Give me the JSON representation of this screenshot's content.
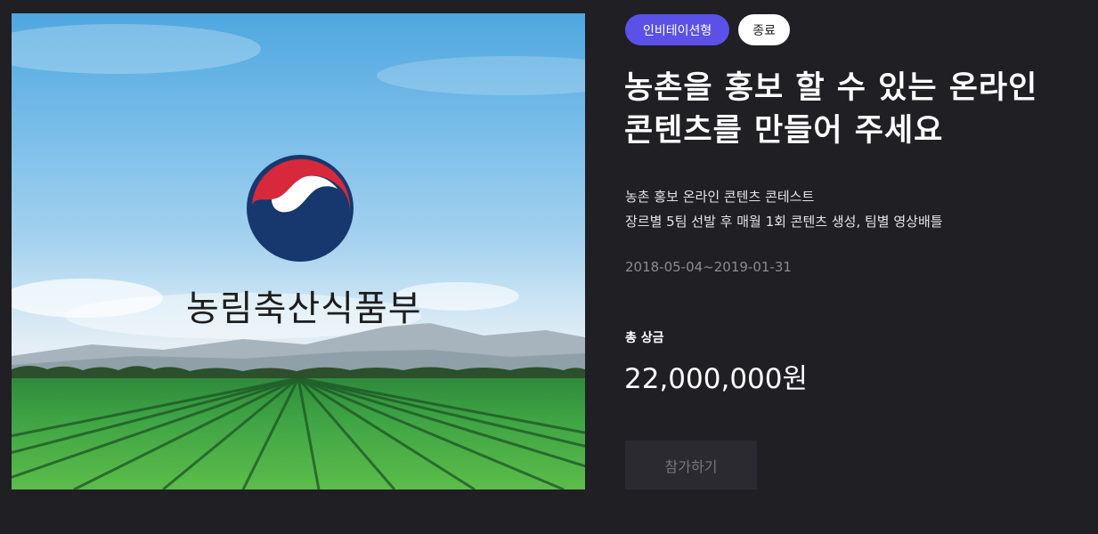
{
  "hero": {
    "ministry_name": "농림축산식품부"
  },
  "badges": {
    "type_label": "인비테이션형",
    "status_label": "종료"
  },
  "contest": {
    "title_line1": "농촌을 홍보 할 수 있는 온라인",
    "title_line2": "콘텐츠를 만들어 주세요",
    "description_line1": "농촌 홍보 온라인 콘텐츠 콘테스트",
    "description_line2": "장르별 5팀 선발 후 매월 1회 콘텐츠 생성, 팀별 영상배틀",
    "period": "2018-05-04~2019-01-31",
    "prize_label": "총 상금",
    "prize_amount": "22,000,000원"
  },
  "actions": {
    "join_label": "참가하기"
  },
  "colors": {
    "background": "#1f1f24",
    "type_badge": "#5b51e6",
    "status_badge": "#ffffff",
    "join_button_bg": "#2a2a30",
    "emblem_red": "#d8283c",
    "emblem_blue": "#17386e"
  }
}
